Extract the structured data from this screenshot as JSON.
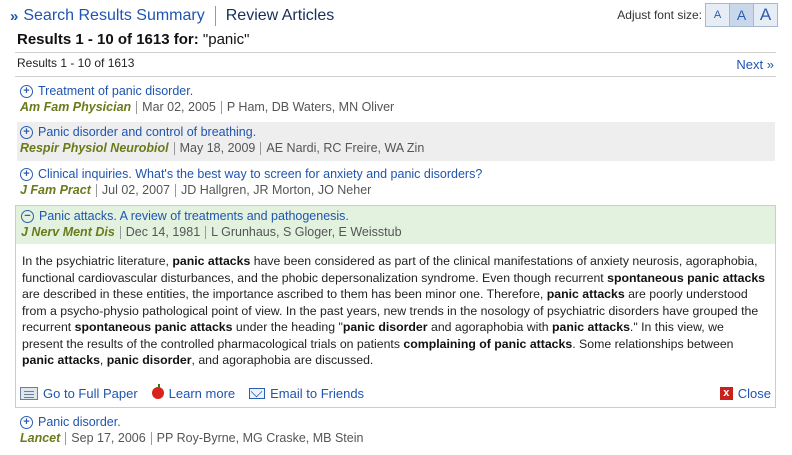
{
  "header": {
    "search_summary": "Search Results Summary",
    "review_articles": "Review Articles",
    "font_size_label": "Adjust font size:",
    "font_buttons": [
      "A",
      "A",
      "A"
    ]
  },
  "results": {
    "title_prefix": "Results 1 - 10 of 1613 for:",
    "query": "\"panic\"",
    "subcount": "Results 1 - 10 of 1613",
    "next_label": "Next »"
  },
  "articles": [
    {
      "title": "Treatment of panic disorder.",
      "journal": "Am Fam Physician",
      "date": "Mar 02, 2005",
      "authors": "P Ham, DB Waters, MN Oliver"
    },
    {
      "title": "Panic disorder and control of breathing.",
      "journal": "Respir Physiol Neurobiol",
      "date": "May 18, 2009",
      "authors": "AE Nardi, RC Freire, WA Zin"
    },
    {
      "title": "Clinical inquiries. What's the best way to screen for anxiety and panic disorders?",
      "journal": "J Fam Pract",
      "date": "Jul 02, 2007",
      "authors": "JD Hallgren, JR Morton, JO Neher"
    },
    {
      "title": "Panic attacks. A review of treatments and pathogenesis.",
      "journal": "J Nerv Ment Dis",
      "date": "Dec 14, 1981",
      "authors": "L Grunhaus, S Gloger, E Weisstub"
    },
    {
      "title": "Panic disorder.",
      "journal": "Lancet",
      "date": "Sep 17, 2006",
      "authors": "PP Roy-Byrne, MG Craske, MB Stein"
    }
  ],
  "abstract": {
    "segments": [
      {
        "t": "In the psychiatric literature, ",
        "b": false
      },
      {
        "t": "panic attacks",
        "b": true
      },
      {
        "t": " have been considered as part of the clinical manifestations of anxiety neurosis, agoraphobia, functional cardiovascular disturbances, and the phobic depersonalization syndrome. Even though recurrent ",
        "b": false
      },
      {
        "t": "spontaneous panic attacks",
        "b": true
      },
      {
        "t": " are described in these entities, the importance ascribed to them has been minor one. Therefore, ",
        "b": false
      },
      {
        "t": "panic attacks",
        "b": true
      },
      {
        "t": " are poorly understood from a psycho-physio pathological point of view. In the past years, new trends in the nosology of psychiatric disorders have grouped the recurrent ",
        "b": false
      },
      {
        "t": "spontaneous panic attacks",
        "b": true
      },
      {
        "t": " under the heading \"",
        "b": false
      },
      {
        "t": "panic disorder",
        "b": true
      },
      {
        "t": " and agoraphobia with ",
        "b": false
      },
      {
        "t": "panic attacks",
        "b": true
      },
      {
        "t": ".\" In this view, we present the results of the controlled pharmacological trials on patients ",
        "b": false
      },
      {
        "t": "complaining of panic attacks",
        "b": true
      },
      {
        "t": ". Some relationships between ",
        "b": false
      },
      {
        "t": "panic attacks",
        "b": true
      },
      {
        "t": ", ",
        "b": false
      },
      {
        "t": "panic disorder",
        "b": true
      },
      {
        "t": ", and agoraphobia are discussed.",
        "b": false
      }
    ]
  },
  "actions": {
    "full_paper": "Go to Full Paper",
    "learn_more": "Learn more",
    "email": "Email to Friends",
    "close": "Close"
  },
  "icons": {
    "expand": "+",
    "collapse": "−",
    "close": "x"
  }
}
